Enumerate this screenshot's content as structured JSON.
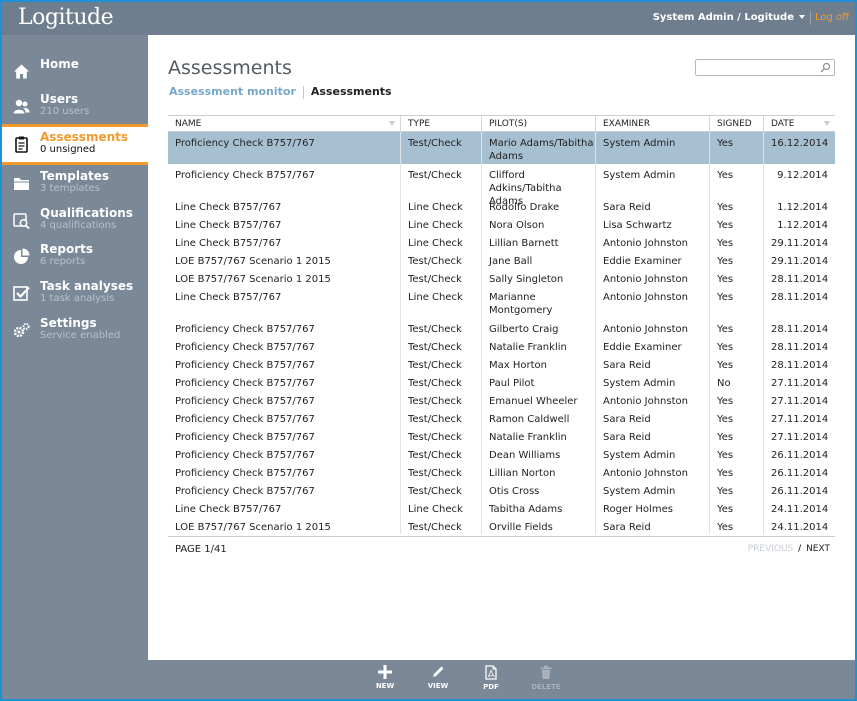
{
  "app": {
    "logo": "Logitude",
    "user_menu": "System Admin / Logitude",
    "logoff": "Log off"
  },
  "sidebar": {
    "items": [
      {
        "label": "Home",
        "sub": "",
        "icon": "home-icon"
      },
      {
        "label": "Users",
        "sub": "210 users",
        "icon": "users-icon"
      },
      {
        "label": "Assessments",
        "sub": "0 unsigned",
        "icon": "clipboard-icon",
        "active": true
      },
      {
        "label": "Templates",
        "sub": "3 templates",
        "icon": "folder-icon"
      },
      {
        "label": "Qualifications",
        "sub": "4 qualifications",
        "icon": "qualification-icon"
      },
      {
        "label": "Reports",
        "sub": "6 reports",
        "icon": "pie-chart-icon"
      },
      {
        "label": "Task analyses",
        "sub": "1 task analysis",
        "icon": "checkbox-icon"
      },
      {
        "label": "Settings",
        "sub": "Service enabled",
        "icon": "gears-icon"
      }
    ]
  },
  "main": {
    "title": "Assessments",
    "breadcrumb": {
      "link": "Assessment monitor",
      "current": "Assessments"
    },
    "search": {
      "value": "",
      "placeholder": ""
    },
    "table": {
      "columns": [
        "NAME",
        "TYPE",
        "PILOT(S)",
        "EXAMINER",
        "SIGNED",
        "DATE"
      ],
      "rows": [
        {
          "name": "Proficiency Check B757/767",
          "type": "Test/Check",
          "pilots": "Mario Adams/Tabitha Adams",
          "examiner": "System Admin",
          "signed": "Yes",
          "date": "16.12.2014",
          "selected": true
        },
        {
          "name": "Proficiency Check B757/767",
          "type": "Test/Check",
          "pilots": "Clifford Adkins/Tabitha Adams",
          "examiner": "System Admin",
          "signed": "Yes",
          "date": "9.12.2014"
        },
        {
          "name": "Line Check B757/767",
          "type": "Line Check",
          "pilots": "Rodolfo Drake",
          "examiner": "Sara Reid",
          "signed": "Yes",
          "date": "1.12.2014"
        },
        {
          "name": "Line Check B757/767",
          "type": "Line Check",
          "pilots": "Nora Olson",
          "examiner": "Lisa Schwartz",
          "signed": "Yes",
          "date": "1.12.2014"
        },
        {
          "name": "Line Check B757/767",
          "type": "Line Check",
          "pilots": "Lillian Barnett",
          "examiner": "Antonio Johnston",
          "signed": "Yes",
          "date": "29.11.2014"
        },
        {
          "name": "LOE B757/767 Scenario 1 2015",
          "type": "Test/Check",
          "pilots": "Jane Ball",
          "examiner": "Eddie Examiner",
          "signed": "Yes",
          "date": "29.11.2014"
        },
        {
          "name": "LOE B757/767 Scenario 1 2015",
          "type": "Test/Check",
          "pilots": "Sally Singleton",
          "examiner": "Antonio Johnston",
          "signed": "Yes",
          "date": "28.11.2014"
        },
        {
          "name": "Line Check B757/767",
          "type": "Line Check",
          "pilots": "Marianne Montgomery",
          "examiner": "Antonio Johnston",
          "signed": "Yes",
          "date": "28.11.2014"
        },
        {
          "name": "Proficiency Check B757/767",
          "type": "Test/Check",
          "pilots": "Gilberto Craig",
          "examiner": "Antonio Johnston",
          "signed": "Yes",
          "date": "28.11.2014"
        },
        {
          "name": "Proficiency Check B757/767",
          "type": "Test/Check",
          "pilots": "Natalie Franklin",
          "examiner": "Eddie Examiner",
          "signed": "Yes",
          "date": "28.11.2014"
        },
        {
          "name": "Proficiency Check B757/767",
          "type": "Test/Check",
          "pilots": "Max Horton",
          "examiner": "Sara Reid",
          "signed": "Yes",
          "date": "28.11.2014"
        },
        {
          "name": "Proficiency Check B757/767",
          "type": "Test/Check",
          "pilots": "Paul Pilot",
          "examiner": "System Admin",
          "signed": "No",
          "date": "27.11.2014"
        },
        {
          "name": "Proficiency Check B757/767",
          "type": "Test/Check",
          "pilots": "Emanuel Wheeler",
          "examiner": "Antonio Johnston",
          "signed": "Yes",
          "date": "27.11.2014"
        },
        {
          "name": "Proficiency Check B757/767",
          "type": "Test/Check",
          "pilots": "Ramon Caldwell",
          "examiner": "Sara Reid",
          "signed": "Yes",
          "date": "27.11.2014"
        },
        {
          "name": "Proficiency Check B757/767",
          "type": "Test/Check",
          "pilots": "Natalie Franklin",
          "examiner": "Sara Reid",
          "signed": "Yes",
          "date": "27.11.2014"
        },
        {
          "name": "Proficiency Check B757/767",
          "type": "Test/Check",
          "pilots": "Dean Williams",
          "examiner": "System Admin",
          "signed": "Yes",
          "date": "26.11.2014"
        },
        {
          "name": "Proficiency Check B757/767",
          "type": "Test/Check",
          "pilots": "Lillian Norton",
          "examiner": "Antonio Johnston",
          "signed": "Yes",
          "date": "26.11.2014"
        },
        {
          "name": "Proficiency Check B757/767",
          "type": "Test/Check",
          "pilots": "Otis Cross",
          "examiner": "System Admin",
          "signed": "Yes",
          "date": "26.11.2014"
        },
        {
          "name": "Line Check B757/767",
          "type": "Line Check",
          "pilots": "Tabitha Adams",
          "examiner": "Roger Holmes",
          "signed": "Yes",
          "date": "24.11.2014"
        },
        {
          "name": "LOE B757/767 Scenario 1 2015",
          "type": "Test/Check",
          "pilots": "Orville Fields",
          "examiner": "Sara Reid",
          "signed": "Yes",
          "date": "24.11.2014"
        }
      ]
    },
    "pager": {
      "page": "PAGE 1/41",
      "previous": "PREVIOUS",
      "separator": "/",
      "next": "NEXT"
    }
  },
  "toolbar": {
    "new": "NEW",
    "view": "VIEW",
    "pdf": "PDF",
    "delete": "DELETE"
  },
  "colors": {
    "accent": "#f39a2b",
    "sidebar": "#7a8898",
    "selected_row": "#a6bfd1",
    "link": "#76a7c8"
  }
}
